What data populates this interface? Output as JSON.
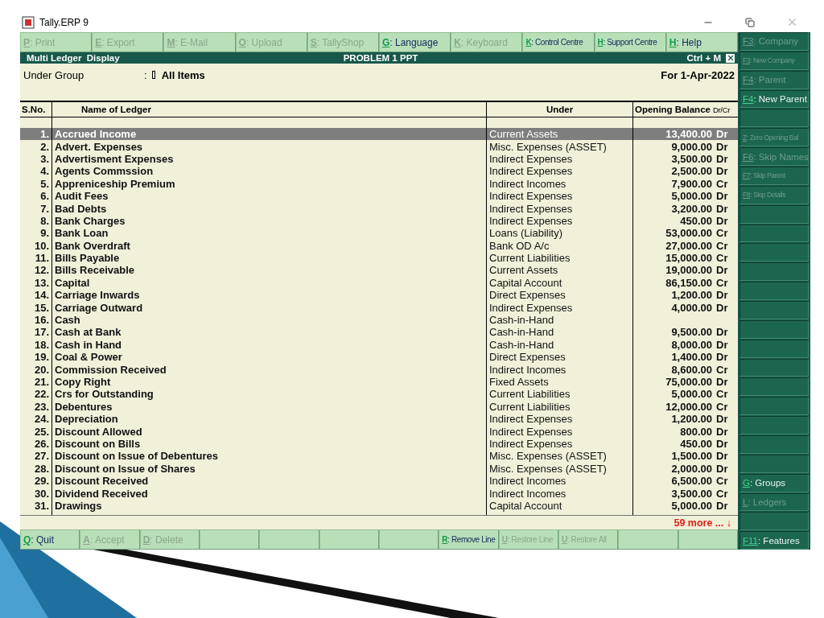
{
  "window": {
    "title": "Tally.ERP 9"
  },
  "top_buttons": [
    {
      "key": "P",
      "label": ": Print",
      "disabled": true
    },
    {
      "key": "E",
      "label": ": Export",
      "disabled": true
    },
    {
      "key": "M",
      "label": ": E-Mail",
      "disabled": true
    },
    {
      "key": "O",
      "label": ": Upload",
      "disabled": true
    },
    {
      "key": "S",
      "label": ": TallyShop",
      "disabled": true
    },
    {
      "key": "G",
      "label": ": Language",
      "disabled": false
    },
    {
      "key": "K",
      "label": ": Keyboard",
      "disabled": true
    },
    {
      "key": "K",
      "label": ": Control Centre",
      "disabled": false
    },
    {
      "key": "H",
      "label": ": Support Centre",
      "disabled": false
    },
    {
      "key": "H",
      "label": ": Help",
      "disabled": false
    }
  ],
  "caption": {
    "title": "Multi Ledger  Display",
    "company": "PROBLEM 1 PPT",
    "shortcut": "Ctrl + M"
  },
  "filter": {
    "label": "Under Group",
    "separator": ":",
    "value": "All Items",
    "period": "For 1-Apr-2022"
  },
  "table": {
    "columns": [
      "S.No.",
      "Name of Ledger",
      "Under",
      "Opening Balance",
      "Dr/Cr"
    ],
    "rows": [
      {
        "no": "1.",
        "name": "Accrued Income",
        "under": "Current Assets",
        "balance": "13,400.00",
        "drcr": "Dr",
        "selected": true
      },
      {
        "no": "2.",
        "name": "Advert. Expenses",
        "under": "Misc. Expenses (ASSET)",
        "balance": "9,000.00",
        "drcr": "Dr",
        "selected": false
      },
      {
        "no": "3.",
        "name": "Advertisment Expenses",
        "under": "Indirect Expenses",
        "balance": "3,500.00",
        "drcr": "Dr",
        "selected": false
      },
      {
        "no": "4.",
        "name": "Agents Commssion",
        "under": "Indirect Expenses",
        "balance": "2,500.00",
        "drcr": "Dr",
        "selected": false
      },
      {
        "no": "5.",
        "name": "Appreniceship Premium",
        "under": "Indirect Incomes",
        "balance": "7,900.00",
        "drcr": "Cr",
        "selected": false
      },
      {
        "no": "6.",
        "name": "Audit Fees",
        "under": "Indirect Expenses",
        "balance": "5,000.00",
        "drcr": "Dr",
        "selected": false
      },
      {
        "no": "7.",
        "name": "Bad Debts",
        "under": "Indirect Expenses",
        "balance": "3,200.00",
        "drcr": "Dr",
        "selected": false
      },
      {
        "no": "8.",
        "name": "Bank Charges",
        "under": "Indirect Expenses",
        "balance": "450.00",
        "drcr": "Dr",
        "selected": false
      },
      {
        "no": "9.",
        "name": "Bank Loan",
        "under": "Loans (Liability)",
        "balance": "53,000.00",
        "drcr": "Cr",
        "selected": false
      },
      {
        "no": "10.",
        "name": "Bank Overdraft",
        "under": "Bank OD A/c",
        "balance": "27,000.00",
        "drcr": "Cr",
        "selected": false
      },
      {
        "no": "11.",
        "name": "Bills Payable",
        "under": "Current Liabilities",
        "balance": "15,000.00",
        "drcr": "Cr",
        "selected": false
      },
      {
        "no": "12.",
        "name": "Bills Receivable",
        "under": "Current Assets",
        "balance": "19,000.00",
        "drcr": "Dr",
        "selected": false
      },
      {
        "no": "13.",
        "name": "Capital",
        "under": "Capital Account",
        "balance": "86,150.00",
        "drcr": "Cr",
        "selected": false
      },
      {
        "no": "14.",
        "name": "Carriage Inwards",
        "under": "Direct Expenses",
        "balance": "1,200.00",
        "drcr": "Dr",
        "selected": false
      },
      {
        "no": "15.",
        "name": "Carriage Outward",
        "under": "Indirect Expenses",
        "balance": "4,000.00",
        "drcr": "Dr",
        "selected": false
      },
      {
        "no": "16.",
        "name": "Cash",
        "under": "Cash-in-Hand",
        "selected": false
      },
      {
        "no": "17.",
        "name": "Cash at Bank",
        "under": "Cash-in-Hand",
        "balance": "9,500.00",
        "drcr": "Dr",
        "selected": false
      },
      {
        "no": "18.",
        "name": "Cash in Hand",
        "under": "Cash-in-Hand",
        "balance": "8,000.00",
        "drcr": "Dr",
        "selected": false
      },
      {
        "no": "19.",
        "name": "Coal & Power",
        "under": "Direct Expenses",
        "balance": "1,400.00",
        "drcr": "Dr",
        "selected": false
      },
      {
        "no": "20.",
        "name": "Commission Received",
        "under": "Indirect Incomes",
        "balance": "8,600.00",
        "drcr": "Cr",
        "selected": false
      },
      {
        "no": "21.",
        "name": "Copy Right",
        "under": "Fixed Assets",
        "balance": "75,000.00",
        "drcr": "Dr",
        "selected": false
      },
      {
        "no": "22.",
        "name": "Crs for Outstanding",
        "under": "Current Liabilities",
        "balance": "5,000.00",
        "drcr": "Cr",
        "selected": false
      },
      {
        "no": "23.",
        "name": "Debentures",
        "under": "Current Liabilities",
        "balance": "12,000.00",
        "drcr": "Cr",
        "selected": false
      },
      {
        "no": "24.",
        "name": "Depreciation",
        "under": "Indirect Expenses",
        "balance": "1,200.00",
        "drcr": "Dr",
        "selected": false
      },
      {
        "no": "25.",
        "name": "Discount Allowed",
        "under": "Indirect Expenses",
        "balance": "800.00",
        "drcr": "Dr",
        "selected": false
      },
      {
        "no": "26.",
        "name": "Discount on Bills",
        "under": "Indirect Expenses",
        "balance": "450.00",
        "drcr": "Dr",
        "selected": false
      },
      {
        "no": "27.",
        "name": "Discount on Issue of Debentures",
        "under": "Misc. Expenses (ASSET)",
        "balance": "1,500.00",
        "drcr": "Dr",
        "selected": false
      },
      {
        "no": "28.",
        "name": "Discount on Issue of Shares",
        "under": "Misc. Expenses (ASSET)",
        "balance": "2,000.00",
        "drcr": "Dr",
        "selected": false
      },
      {
        "no": "29.",
        "name": "Discount Received",
        "under": "Indirect Incomes",
        "balance": "6,500.00",
        "drcr": "Cr",
        "selected": false
      },
      {
        "no": "30.",
        "name": "Dividend Received",
        "under": "Indirect Incomes",
        "balance": "3,500.00",
        "drcr": "Cr",
        "selected": false
      },
      {
        "no": "31.",
        "name": "Drawings",
        "under": "Capital Account",
        "balance": "5,000.00",
        "drcr": "Dr",
        "selected": false
      }
    ],
    "more": "59 more ... ↓"
  },
  "bottom_buttons": [
    {
      "kind": "key",
      "key": "Q",
      "label": ": Quit",
      "disabled": false
    },
    {
      "kind": "key",
      "key": "A",
      "label": ": Accept",
      "disabled": true
    },
    {
      "kind": "key",
      "key": "D",
      "label": ": Delete",
      "disabled": true
    },
    {
      "kind": "blank"
    },
    {
      "kind": "blank"
    },
    {
      "kind": "blank"
    },
    {
      "kind": "blank"
    },
    {
      "kind": "key",
      "key": "R",
      "label": ": Remove Line",
      "disabled": false
    },
    {
      "kind": "key",
      "key": "U",
      "label": ": Restore Line",
      "disabled": true
    },
    {
      "kind": "key",
      "key": "U",
      "label": ": Restore All",
      "disabled": true
    },
    {
      "kind": "blank"
    },
    {
      "kind": "blank"
    }
  ],
  "side_buttons": [
    {
      "kind": "key",
      "key": "F3",
      "label": ": Company",
      "disabled": true
    },
    {
      "kind": "key",
      "key": "F3",
      "label": ": New Company",
      "disabled": true
    },
    {
      "kind": "key",
      "key": "F4",
      "label": ": Parent",
      "disabled": true
    },
    {
      "kind": "key",
      "key": "F4",
      "label": ": New Parent",
      "disabled": false
    },
    {
      "kind": "blank"
    },
    {
      "kind": "key",
      "key": "Z",
      "label": ": Zero Opening Bal",
      "disabled": true
    },
    {
      "kind": "key",
      "key": "F6",
      "label": ": Skip Names",
      "disabled": true
    },
    {
      "kind": "key",
      "key": "F7",
      "label": ": Skip Parent",
      "disabled": true
    },
    {
      "kind": "key",
      "key": "F8",
      "label": ": Skip Details",
      "disabled": true
    },
    {
      "kind": "blank"
    },
    {
      "kind": "blank"
    },
    {
      "kind": "blank"
    },
    {
      "kind": "blank"
    },
    {
      "kind": "blank"
    },
    {
      "kind": "blank"
    },
    {
      "kind": "blank"
    },
    {
      "kind": "blank"
    },
    {
      "kind": "blank"
    },
    {
      "kind": "blank"
    },
    {
      "kind": "blank"
    },
    {
      "kind": "blank"
    },
    {
      "kind": "blank"
    },
    {
      "kind": "blank"
    },
    {
      "kind": "key",
      "key": "G",
      "label": ": Groups",
      "disabled": false
    },
    {
      "kind": "key",
      "key": "L",
      "label": ": Ledgers",
      "disabled": true
    },
    {
      "kind": "blank"
    },
    {
      "kind": "key",
      "key": "F11",
      "label": ": Features",
      "disabled": false
    }
  ]
}
